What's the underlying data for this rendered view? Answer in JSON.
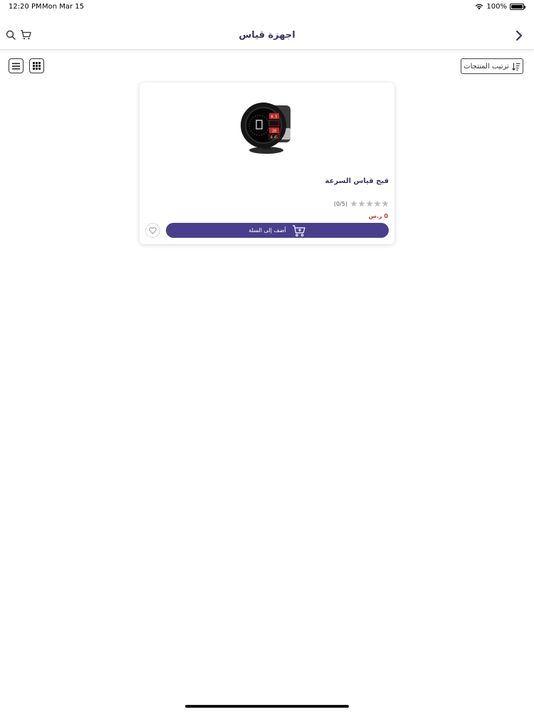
{
  "status_bar": {
    "time": "12:20 PM",
    "date": "Mon Mar 15",
    "battery": "100%"
  },
  "header": {
    "title": "اجهزة قياس",
    "back_icon": "chevron-right-icon",
    "search_icon": "search-icon",
    "cart_icon": "cart-icon"
  },
  "toolbar": {
    "sort_label": "ترتيب المنتجات",
    "sort_icon": "sort-icon",
    "list_view_icon": "list-view-icon",
    "grid_view_icon": "grid-view-icon"
  },
  "products": [
    {
      "name": "قيج قياس السرعة",
      "rating": 0,
      "rating_max": 5,
      "rating_text": "(0/5)",
      "price": "0",
      "currency": "ر.س",
      "add_to_cart_label": "أضف إلى السلة",
      "screen_readouts": [
        "0.5",
        "20",
        "0.45"
      ]
    }
  ],
  "colors": {
    "primary": "#4a3f8c",
    "title": "#3a3563",
    "price": "#c0392b",
    "star_empty": "#bdbdbd"
  }
}
